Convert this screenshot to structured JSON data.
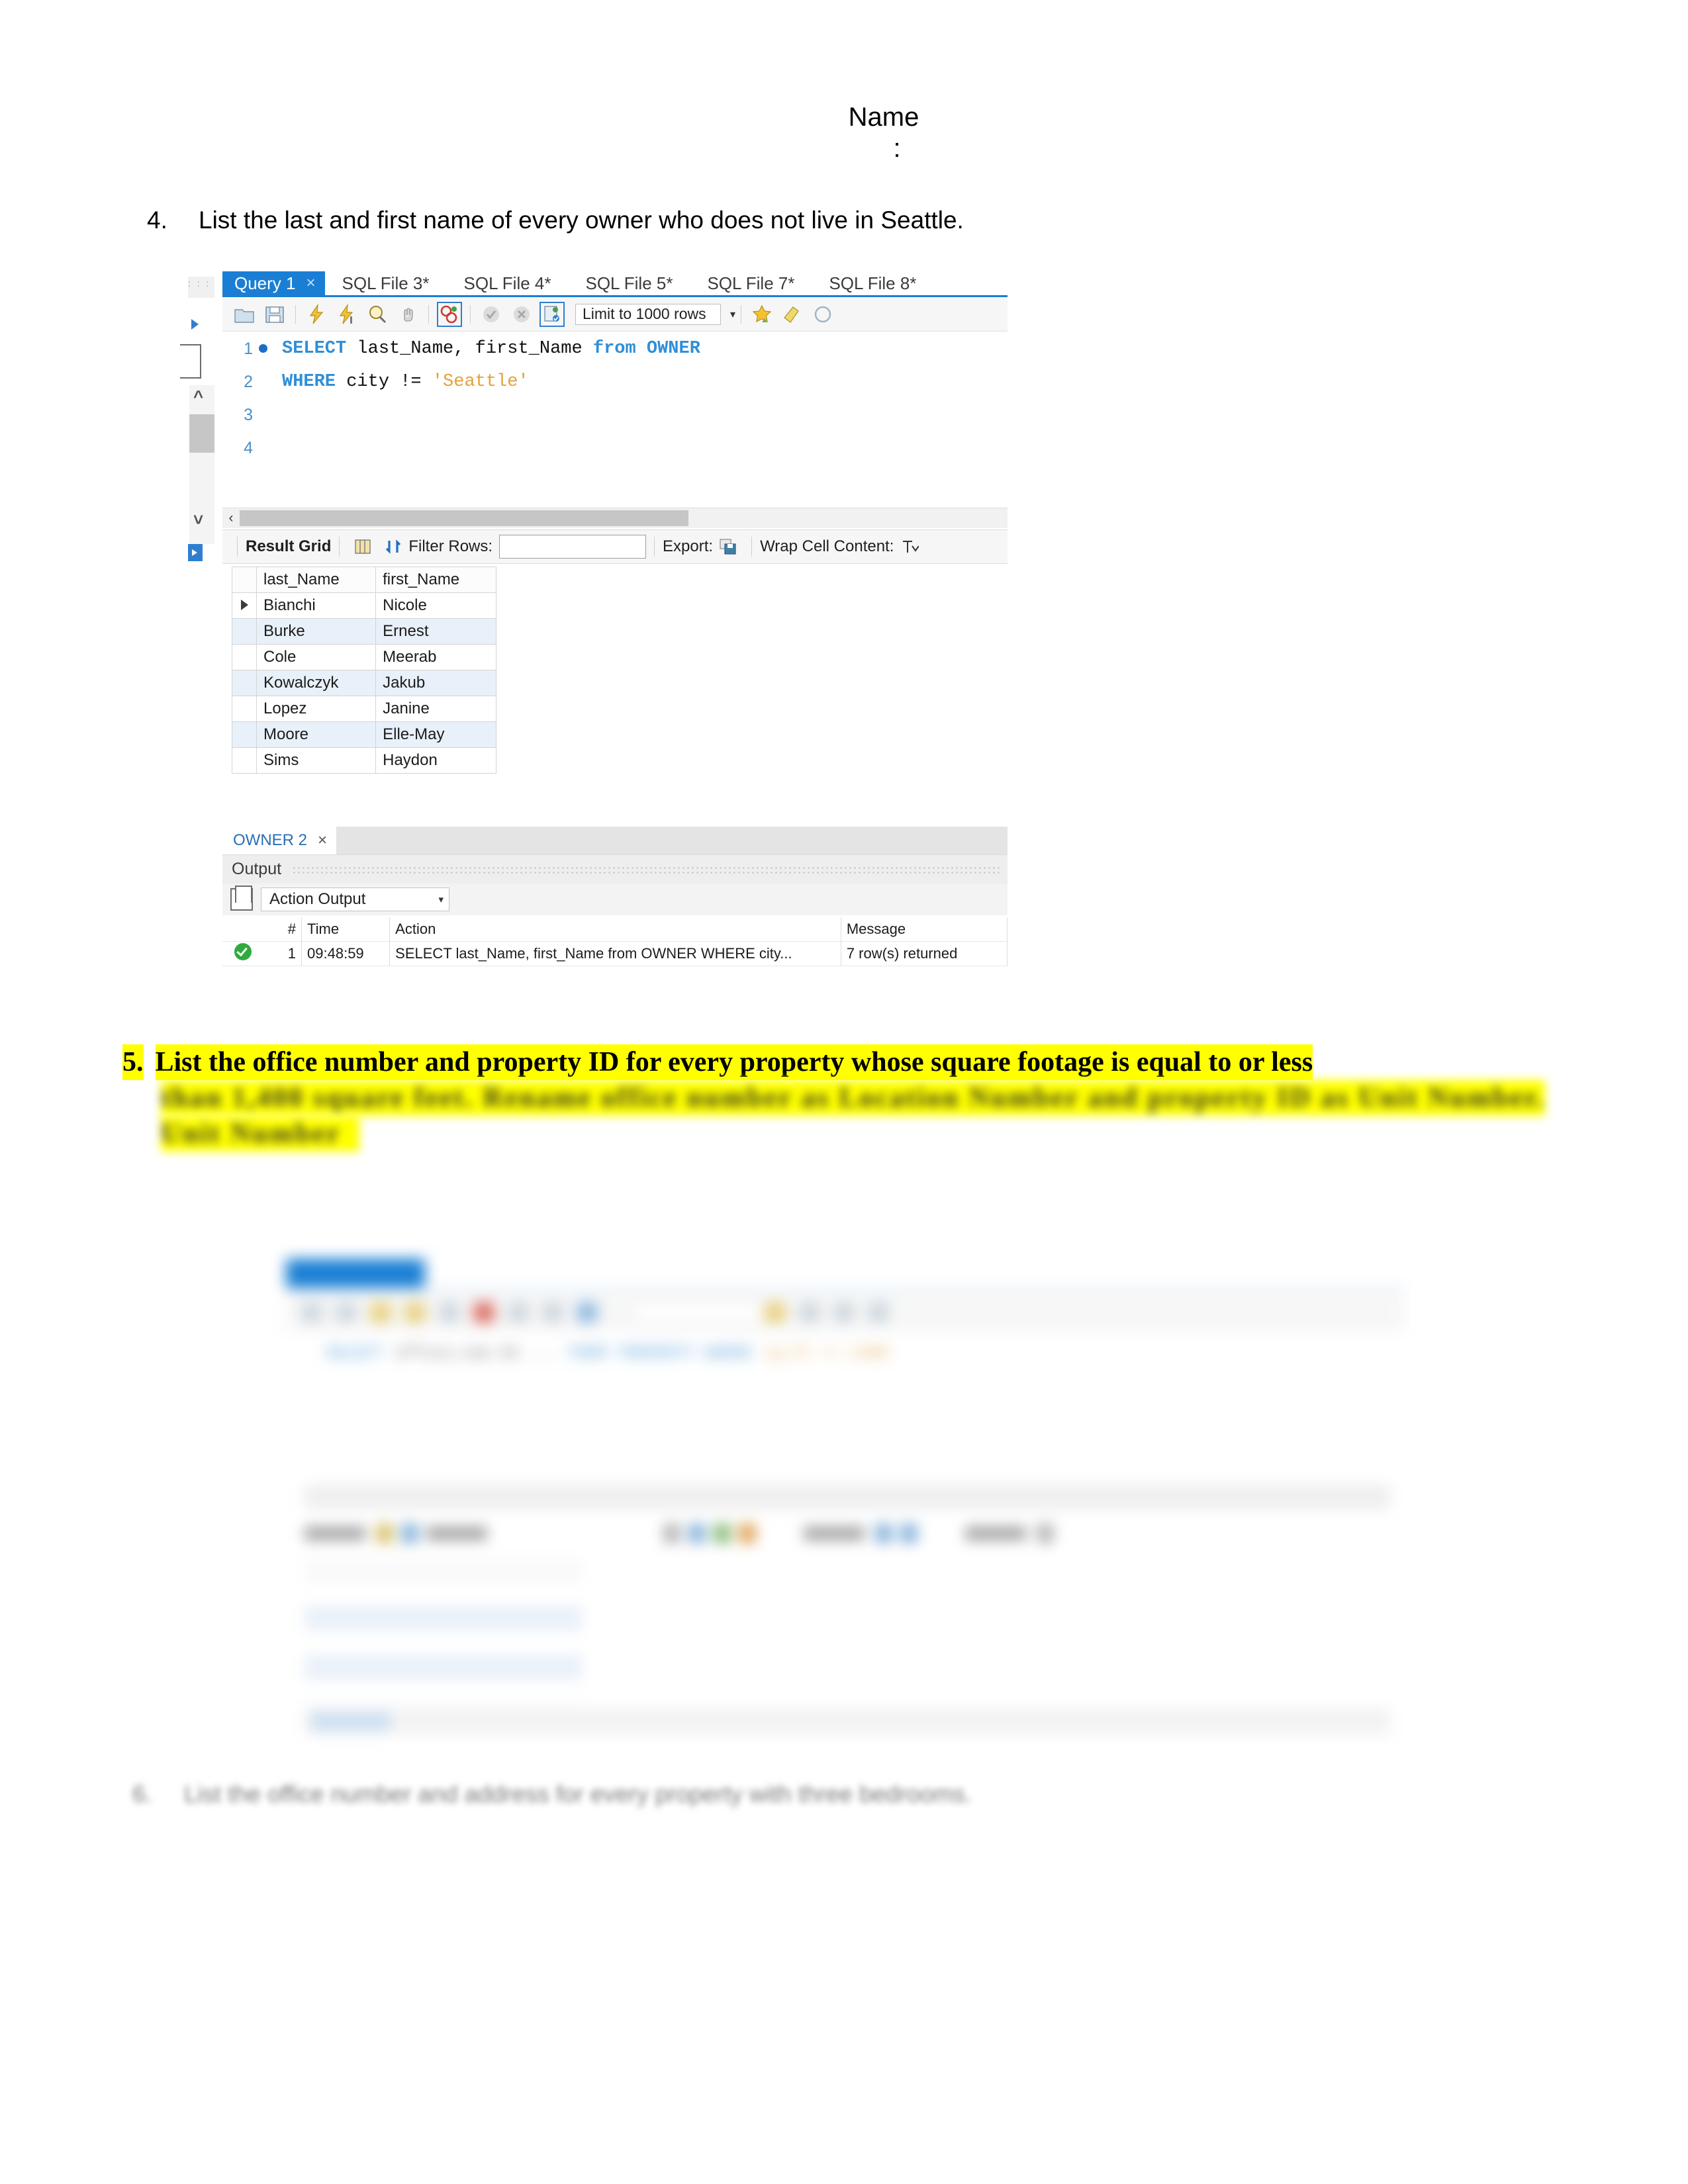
{
  "document": {
    "header_name": "Name",
    "header_colon": ":"
  },
  "question4": {
    "number": "4.",
    "text": "List the last and first name of every owner who does not live in Seattle."
  },
  "workbench1": {
    "tabs": [
      {
        "label": "Query 1",
        "active": true,
        "close": "×"
      },
      {
        "label": "SQL File 3*",
        "active": false
      },
      {
        "label": "SQL File 4*",
        "active": false
      },
      {
        "label": "SQL File 5*",
        "active": false
      },
      {
        "label": "SQL File 7*",
        "active": false
      },
      {
        "label": "SQL File 8*",
        "active": false
      }
    ],
    "toolbar": {
      "limit_label": "Limit to 1000 rows",
      "caret": "▾",
      "icons": [
        "open-sql-script-icon",
        "save-sql-script-icon",
        "execute-statement-icon",
        "execute-current-statement-icon",
        "explain-query-icon",
        "stop-query-icon",
        "toggle-statement-boundary-icon",
        "commit-icon",
        "rollback-icon",
        "auto-commit-icon",
        "beautify-sql-icon",
        "find-icon",
        "toggle-invisible-chars-icon"
      ]
    },
    "editor": {
      "lines": [
        {
          "num": "1",
          "breakpoint": true,
          "tokens": [
            {
              "t": "kw",
              "v": "SELECT"
            },
            {
              "t": "sp",
              "v": " "
            },
            {
              "t": "id",
              "v": "last_Name, first_Name"
            },
            {
              "t": "sp",
              "v": " "
            },
            {
              "t": "kw",
              "v": "from"
            },
            {
              "t": "sp",
              "v": " "
            },
            {
              "t": "tbl",
              "v": "OWNER"
            }
          ]
        },
        {
          "num": "2",
          "breakpoint": false,
          "tokens": [
            {
              "t": "kw",
              "v": "WHERE"
            },
            {
              "t": "sp",
              "v": " "
            },
            {
              "t": "id",
              "v": "city"
            },
            {
              "t": "sp",
              "v": " "
            },
            {
              "t": "op",
              "v": "!="
            },
            {
              "t": "sp",
              "v": " "
            },
            {
              "t": "str",
              "v": "'Seattle'"
            }
          ]
        },
        {
          "num": "3",
          "breakpoint": false,
          "tokens": []
        },
        {
          "num": "4",
          "breakpoint": false,
          "tokens": []
        }
      ]
    },
    "result_toolbar": {
      "result_grid_label": "Result Grid",
      "filter_rows_label": "Filter Rows:",
      "filter_value": "",
      "export_label": "Export:",
      "wrap_cell_label": "Wrap Cell Content:",
      "wrap_cell_icon_text": "IA"
    },
    "result_grid": {
      "columns": [
        "last_Name",
        "first_Name"
      ],
      "rows": [
        {
          "last_Name": "Bianchi",
          "first_Name": "Nicole",
          "current": true
        },
        {
          "last_Name": "Burke",
          "first_Name": "Ernest",
          "current": false
        },
        {
          "last_Name": "Cole",
          "first_Name": "Meerab",
          "current": false
        },
        {
          "last_Name": "Kowalczyk",
          "first_Name": "Jakub",
          "current": false
        },
        {
          "last_Name": "Lopez",
          "first_Name": "Janine",
          "current": false
        },
        {
          "last_Name": "Moore",
          "first_Name": "Elle-May",
          "current": false
        },
        {
          "last_Name": "Sims",
          "first_Name": "Haydon",
          "current": false
        }
      ]
    },
    "owner_tab": {
      "label": "OWNER 2",
      "close": "×"
    },
    "output": {
      "panel_label": "Output",
      "selector_label": "Action Output",
      "selector_caret": "▾",
      "columns": [
        "#",
        "Time",
        "Action",
        "Message"
      ],
      "rows": [
        {
          "status": "success",
          "num": "1",
          "time": "09:48:59",
          "action": "SELECT last_Name, first_Name from OWNER WHERE city...",
          "message": "7 row(s) returned"
        }
      ]
    }
  },
  "question5": {
    "number": "5.",
    "line1": "List the office number and property ID for every property whose square footage is equal to or less",
    "line2_blurred": "than 1,400 square feet. Rename office number as Location Number and property ID as Unit Number.",
    "line3_blurred": "Unit Number",
    "highlight_color": "#ffff00"
  },
  "workbench2_blurred": {
    "description": "blurred-mysql-workbench-editor",
    "tabs": [
      "",
      "",
      "",
      "",
      "",
      "",
      ""
    ],
    "code_tokens": [
      "SELECT",
      "office_num AS ...",
      "FROM",
      "PROPERTY WHERE",
      "sq_ft <= 1400"
    ]
  },
  "workbench3_blurred": {
    "description": "blurred-mysql-workbench-result-grid",
    "columns": [
      "",
      ""
    ],
    "rows": [
      [
        "",
        ""
      ],
      [
        "",
        ""
      ],
      [
        "",
        ""
      ],
      [
        "",
        ""
      ],
      [
        "",
        ""
      ]
    ]
  },
  "question6": {
    "number": "6.",
    "text_blurred": "List the office number and address for every property with three bedrooms."
  }
}
